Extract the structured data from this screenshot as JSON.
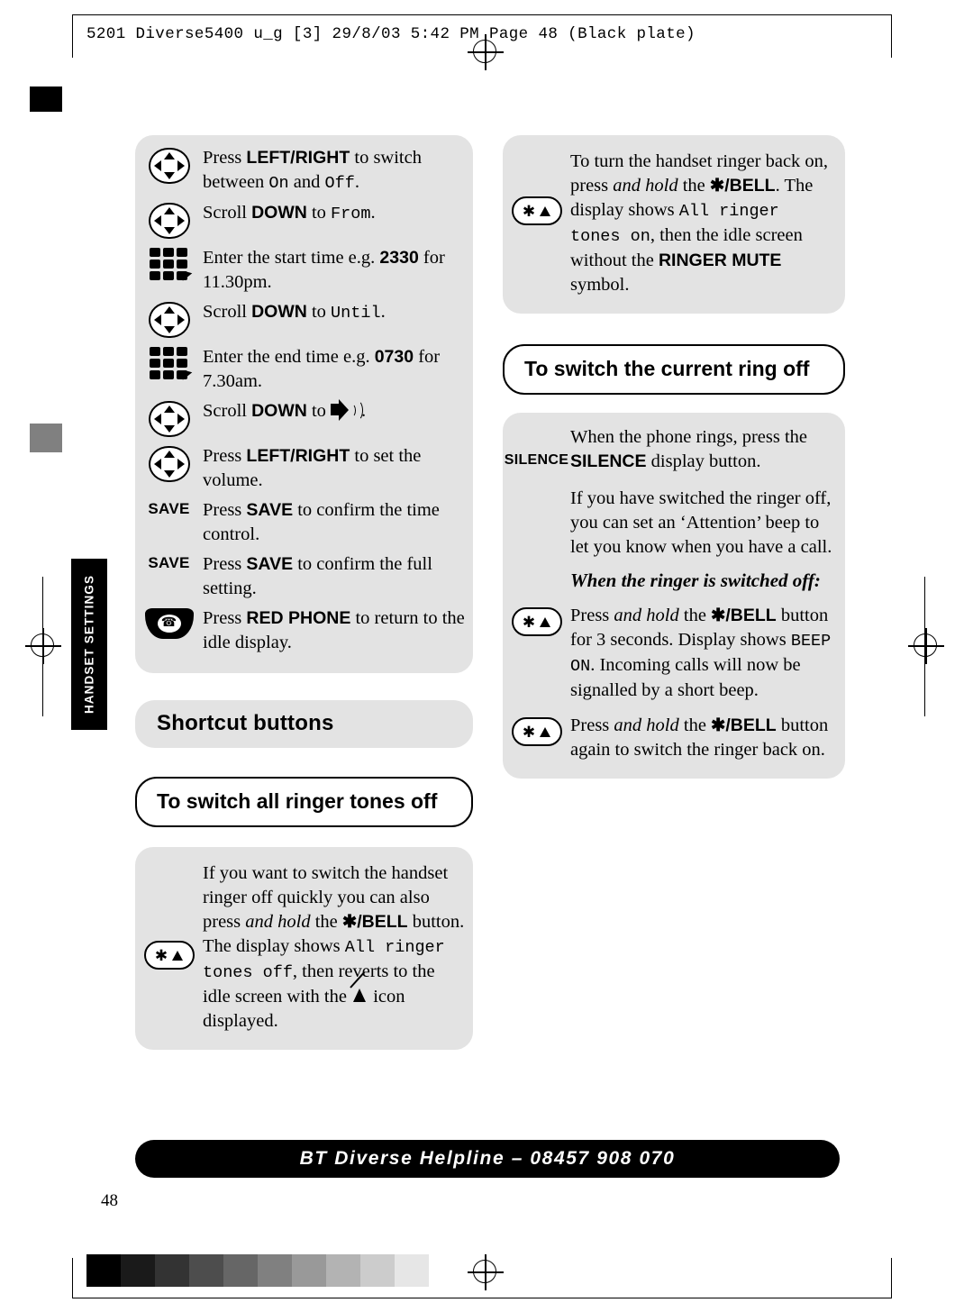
{
  "header": {
    "slug": "5201 Diverse5400  u_g [3]  29/8/03  5:42 PM  Page 48       (Black plate)"
  },
  "side_tab": {
    "label": "HANDSET SETTINGS"
  },
  "left_column": {
    "steps": [
      {
        "icon": "navigation-pad-icon",
        "parts": [
          {
            "t": "Press ",
            "s": "n"
          },
          {
            "t": "LEFT/RIGHT",
            "s": "b"
          },
          {
            "t": " to switch between ",
            "s": "n"
          },
          {
            "t": "On",
            "s": "m"
          },
          {
            "t": " and ",
            "s": "n"
          },
          {
            "t": "Off",
            "s": "m"
          },
          {
            "t": ".",
            "s": "n"
          }
        ]
      },
      {
        "icon": "navigation-pad-icon",
        "parts": [
          {
            "t": "Scroll ",
            "s": "n"
          },
          {
            "t": "DOWN",
            "s": "b"
          },
          {
            "t": " to ",
            "s": "n"
          },
          {
            "t": "From",
            "s": "m"
          },
          {
            "t": ".",
            "s": "n"
          }
        ]
      },
      {
        "icon": "keypad-icon",
        "parts": [
          {
            "t": "Enter the start time e.g. ",
            "s": "n"
          },
          {
            "t": "2330",
            "s": "b"
          },
          {
            "t": " for 11.30pm.",
            "s": "n"
          }
        ]
      },
      {
        "icon": "navigation-pad-icon",
        "parts": [
          {
            "t": "Scroll ",
            "s": "n"
          },
          {
            "t": "DOWN",
            "s": "b"
          },
          {
            "t": " to ",
            "s": "n"
          },
          {
            "t": "Until",
            "s": "m"
          },
          {
            "t": ".",
            "s": "n"
          }
        ]
      },
      {
        "icon": "keypad-icon",
        "parts": [
          {
            "t": "Enter the end time e.g. ",
            "s": "n"
          },
          {
            "t": "0730",
            "s": "b"
          },
          {
            "t": " for 7.30am.",
            "s": "n"
          }
        ]
      },
      {
        "icon": "navigation-pad-icon",
        "parts": [
          {
            "t": "Scroll ",
            "s": "n"
          },
          {
            "t": "DOWN",
            "s": "b"
          },
          {
            "t": " to ",
            "s": "n"
          },
          {
            "t": "[volume-icon]",
            "s": "i"
          },
          {
            "t": ".",
            "s": "n"
          }
        ]
      },
      {
        "icon": "navigation-pad-icon",
        "parts": [
          {
            "t": "Press ",
            "s": "n"
          },
          {
            "t": "LEFT/RIGHT",
            "s": "b"
          },
          {
            "t": " to set the volume.",
            "s": "n"
          }
        ]
      },
      {
        "icon": "save-softkey",
        "icon_label": "SAVE",
        "parts": [
          {
            "t": "Press ",
            "s": "n"
          },
          {
            "t": "SAVE",
            "s": "b"
          },
          {
            "t": " to confirm the time control.",
            "s": "n"
          }
        ]
      },
      {
        "icon": "save-softkey",
        "icon_label": "SAVE",
        "parts": [
          {
            "t": "Press ",
            "s": "n"
          },
          {
            "t": "SAVE",
            "s": "b"
          },
          {
            "t": " to confirm the full setting.",
            "s": "n"
          }
        ]
      },
      {
        "icon": "red-phone-icon",
        "parts": [
          {
            "t": "Press ",
            "s": "n"
          },
          {
            "t": "RED PHONE",
            "s": "b"
          },
          {
            "t": " to return to the idle display.",
            "s": "n"
          }
        ]
      }
    ],
    "section_heading": "Shortcut buttons",
    "callout_heading": "To switch all ringer tones off",
    "callout_body": [
      {
        "t": "If you want to switch the handset ringer off quickly you can also press ",
        "s": "n"
      },
      {
        "t": "and hold",
        "s": "it"
      },
      {
        "t": " the ",
        "s": "n"
      },
      {
        "t": "✱/BELL",
        "s": "b"
      },
      {
        "t": " button. The display shows ",
        "s": "n"
      },
      {
        "t": "All ringer tones off",
        "s": "m"
      },
      {
        "t": ", then reverts to the idle screen with the ",
        "s": "n"
      },
      {
        "t": "[bell-off-icon]",
        "s": "i"
      },
      {
        "t": " icon displayed.",
        "s": "n"
      }
    ],
    "callout_icon": "star-bell-key-icon"
  },
  "right_column": {
    "top_block": [
      {
        "t": "To turn the handset ringer back on, press ",
        "s": "n"
      },
      {
        "t": "and hold",
        "s": "it"
      },
      {
        "t": " the ",
        "s": "n"
      },
      {
        "t": "✱/BELL",
        "s": "b"
      },
      {
        "t": ". The display shows ",
        "s": "n"
      },
      {
        "t": "All ringer tones on",
        "s": "m"
      },
      {
        "t": ", then the idle screen without the ",
        "s": "n"
      },
      {
        "t": "RINGER MUTE",
        "s": "b"
      },
      {
        "t": " symbol.",
        "s": "n"
      }
    ],
    "top_block_icon": "star-bell-key-icon",
    "callout_heading": "To switch the current ring off",
    "silence_label": "SILENCE",
    "para1": [
      {
        "t": "When the phone rings, press the ",
        "s": "n"
      },
      {
        "t": "SILENCE",
        "s": "b"
      },
      {
        "t": " display button.",
        "s": "n"
      }
    ],
    "para2": [
      {
        "t": "If you have switched the ringer off, you can set an ‘Attention’ beep to let you know when you have a call.",
        "s": "n"
      }
    ],
    "subheading": "When the ringer is switched off:",
    "para3": [
      {
        "t": "Press ",
        "s": "n"
      },
      {
        "t": "and hold",
        "s": "it"
      },
      {
        "t": " the ",
        "s": "n"
      },
      {
        "t": "✱/BELL",
        "s": "b"
      },
      {
        "t": " button for 3 seconds. Display shows ",
        "s": "n"
      },
      {
        "t": "BEEP ON",
        "s": "m"
      },
      {
        "t": ". Incoming calls will now be signalled by a short beep.",
        "s": "n"
      }
    ],
    "para3_icon": "star-bell-key-icon",
    "para4": [
      {
        "t": "Press ",
        "s": "n"
      },
      {
        "t": "and hold",
        "s": "it"
      },
      {
        "t": " the ",
        "s": "n"
      },
      {
        "t": "✱/BELL",
        "s": "b"
      },
      {
        "t": " button again to switch the ringer back on.",
        "s": "n"
      }
    ],
    "para4_icon": "star-bell-key-icon"
  },
  "footer": {
    "helpline": "BT Diverse Helpline – 08457 908 070",
    "page_number": "48"
  },
  "greyscale_bar": [
    "#000000",
    "#1a1a1a",
    "#333333",
    "#4d4d4d",
    "#666666",
    "#808080",
    "#999999",
    "#b3b3b3",
    "#cccccc",
    "#e6e6e6"
  ]
}
